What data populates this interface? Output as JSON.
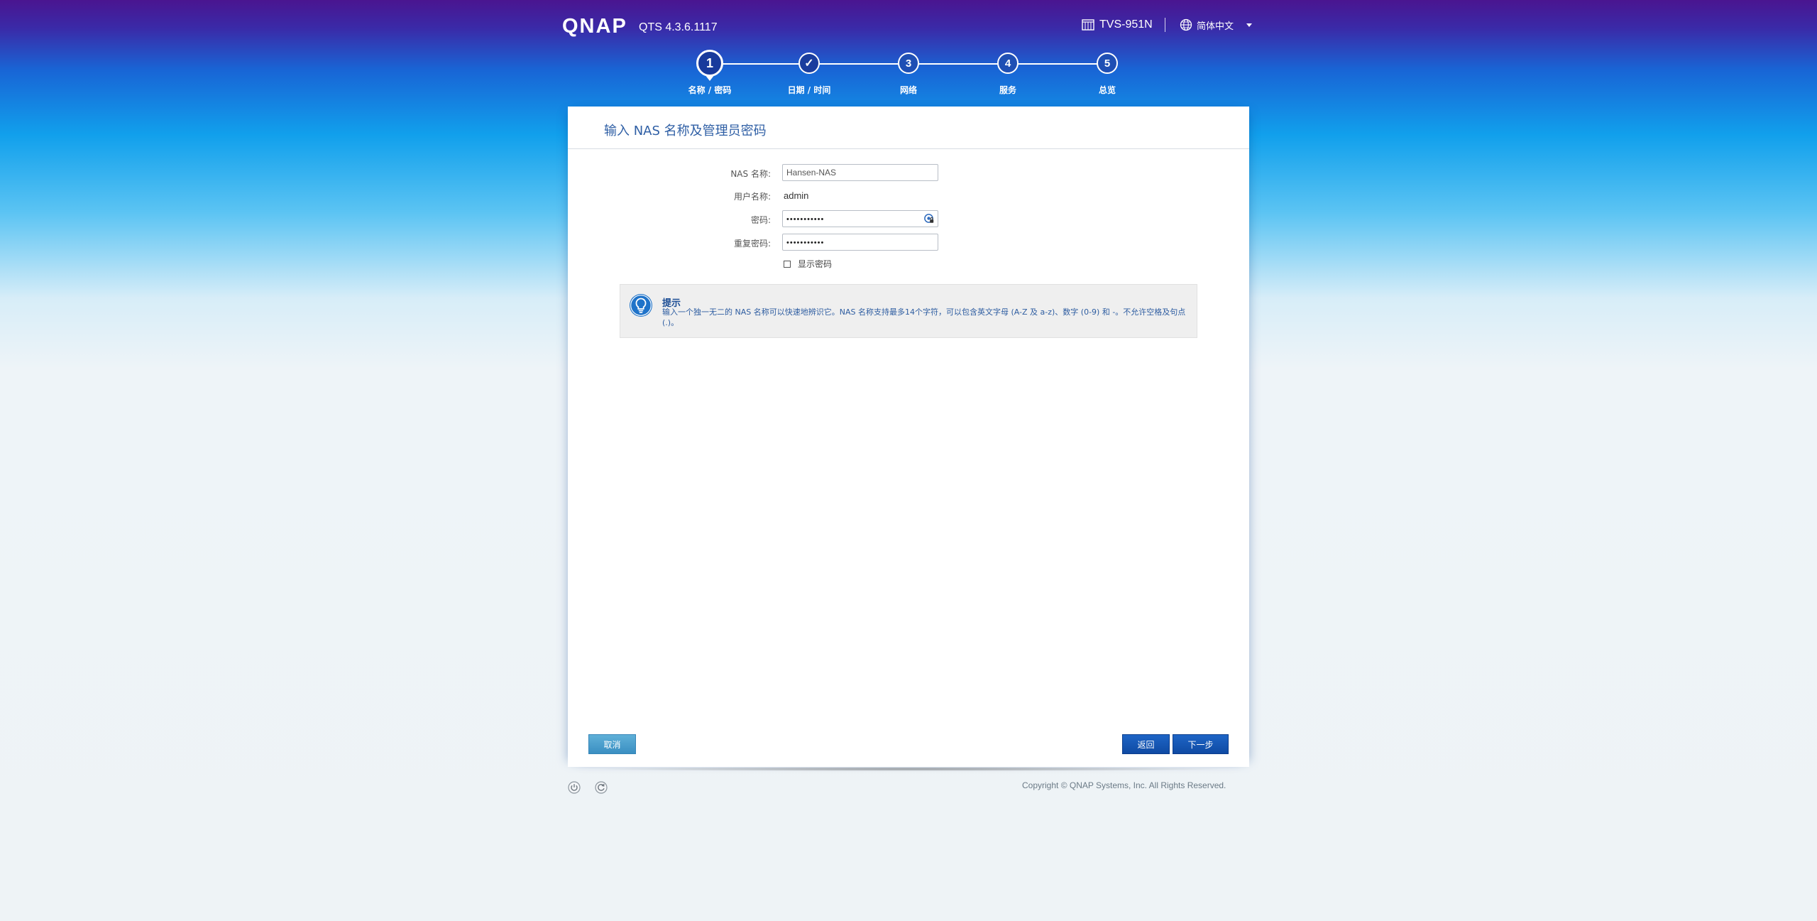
{
  "header": {
    "logo": "QNAP",
    "version": "QTS 4.3.6.1117",
    "device": "TVS-951N",
    "language": "简体中文",
    "device_icon": "nas-device-icon",
    "language_icon": "globe-icon"
  },
  "stepper": {
    "steps": [
      {
        "number": "1",
        "label": "名称 / 密码",
        "state": "active"
      },
      {
        "number": "✓",
        "label": "日期 / 时间",
        "state": "done"
      },
      {
        "number": "3",
        "label": "网络",
        "state": "pending"
      },
      {
        "number": "4",
        "label": "服务",
        "state": "pending"
      },
      {
        "number": "5",
        "label": "总览",
        "state": "pending"
      }
    ]
  },
  "panel": {
    "title": "输入 NAS 名称及管理员密码"
  },
  "form": {
    "nas_name_label": "NAS 名称:",
    "nas_name_value": "Hansen-NAS",
    "username_label": "用户名称:",
    "username_value": "admin",
    "password_label": "密码:",
    "password_value": "•••••••••••",
    "confirm_label": "重复密码:",
    "confirm_value": "•••••••••••",
    "show_password_label": "显示密码",
    "show_password_checked": false
  },
  "tip": {
    "title": "提示",
    "text": "输入一个独一无二的 NAS 名称可以快速地辨识它。NAS 名称支持最多14个字符，可以包含英文字母 (A-Z 及 a-z)、数字 (0-9) 和 -。不允许空格及句点 (.)。",
    "icon": "lightbulb-icon"
  },
  "buttons": {
    "cancel": "取消",
    "back": "返回",
    "next": "下一步"
  },
  "footer": {
    "copyright": "Copyright © QNAP Systems, Inc. All Rights Reserved.",
    "power_icon": "power-icon",
    "restart_icon": "restart-icon"
  },
  "colors": {
    "accent": "#1f5fb8",
    "title": "#2f5fa5",
    "header_top": "#4a1590",
    "header_bottom": "#11a0ec"
  }
}
